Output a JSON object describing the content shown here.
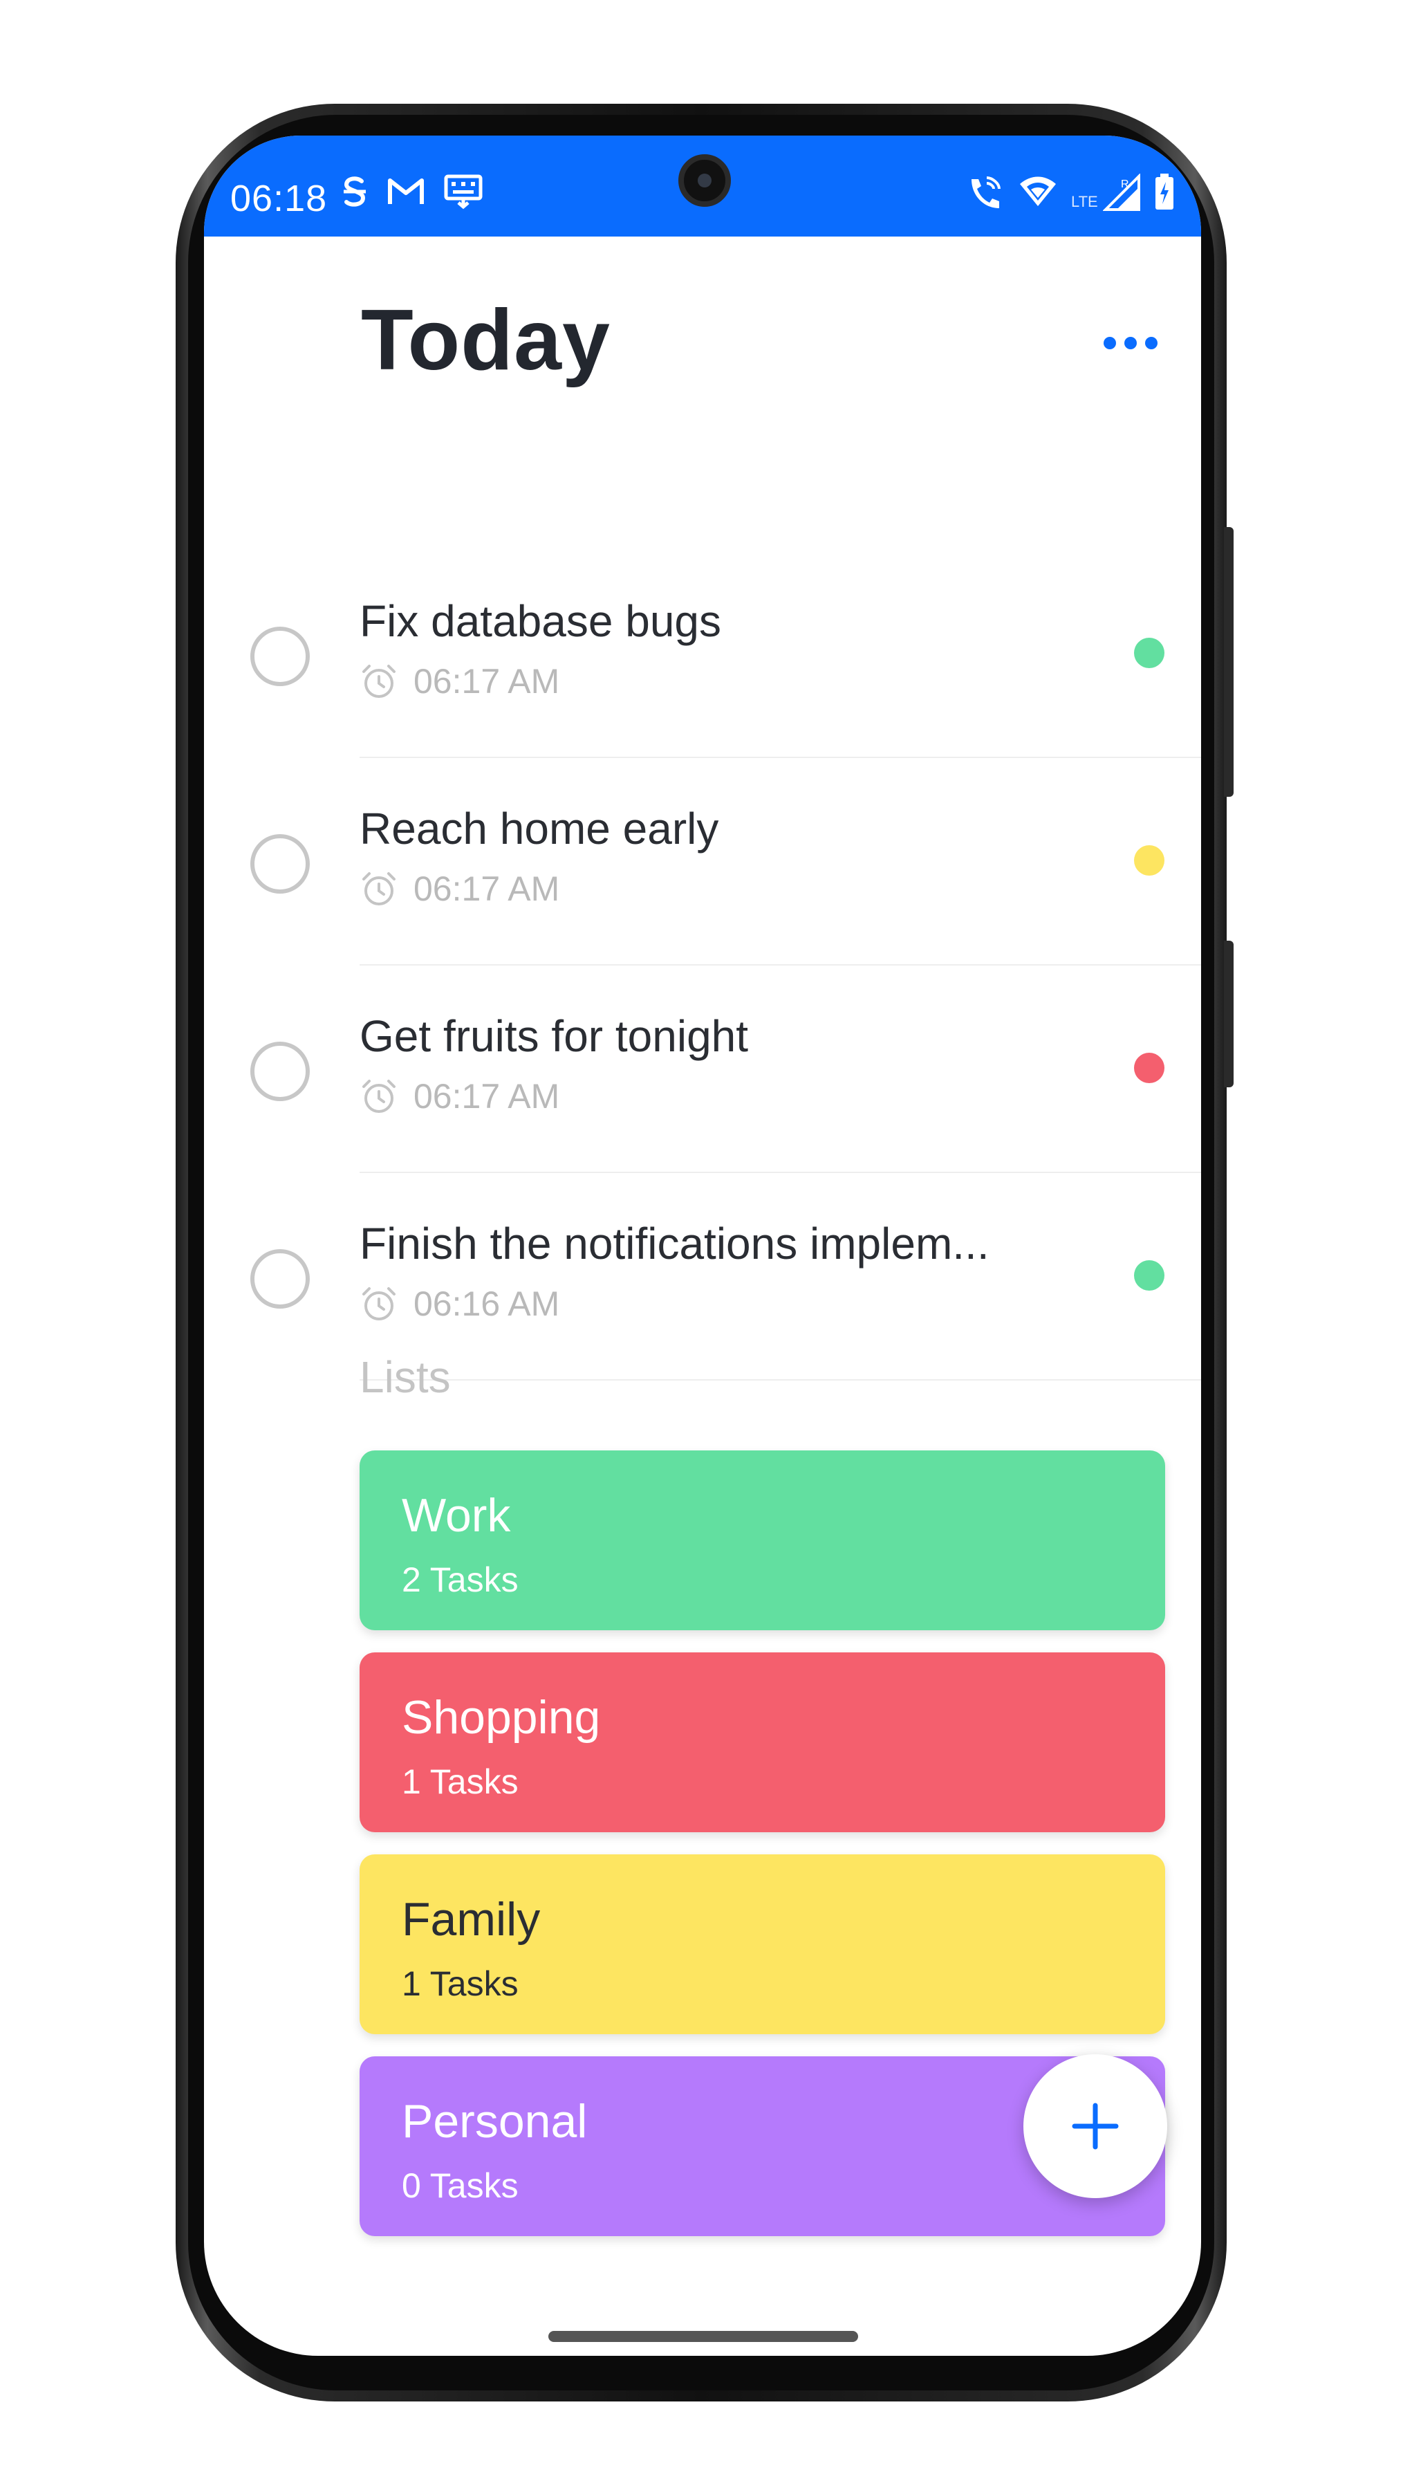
{
  "status_bar": {
    "time": "06:18",
    "left_icons": [
      "s-icon",
      "gmail-icon",
      "keyboard-icon"
    ],
    "right_icons": [
      "wifi-call-icon",
      "wifi-icon",
      "lte-signal-icon",
      "battery-charging-icon"
    ],
    "lte_label": "LTE",
    "background_color": "#0a6cfe"
  },
  "header": {
    "title": "Today",
    "more_icon": "more-horizontal-icon"
  },
  "tasks": [
    {
      "title": "Fix database bugs",
      "time": "06:17 AM",
      "dot_color": "#62dfa0"
    },
    {
      "title": "Reach home early",
      "time": "06:17 AM",
      "dot_color": "#fde561"
    },
    {
      "title": "Get fruits for tonight",
      "time": "06:17 AM",
      "dot_color": "#f45f6e"
    },
    {
      "title": "Finish the notifications implem...",
      "time": "06:16 AM",
      "dot_color": "#62dfa0"
    }
  ],
  "lists": {
    "heading": "Lists",
    "items": [
      {
        "name": "Work",
        "count": "2 Tasks",
        "color": "#62dfa0",
        "text_color": "#ffffff"
      },
      {
        "name": "Shopping",
        "count": "1 Tasks",
        "color": "#f45f6e",
        "text_color": "#ffffff"
      },
      {
        "name": "Family",
        "count": "1 Tasks",
        "color": "#fde561",
        "text_color": "#2a2d33"
      },
      {
        "name": "Personal",
        "count": "0 Tasks",
        "color": "#b57afc",
        "text_color": "#ffffff"
      }
    ]
  },
  "fab": {
    "icon": "plus-icon",
    "color": "#0a6cfe"
  },
  "colors": {
    "accent": "#0a6cfe",
    "title_text": "#23272f",
    "muted_text": "#b9b9b9"
  }
}
